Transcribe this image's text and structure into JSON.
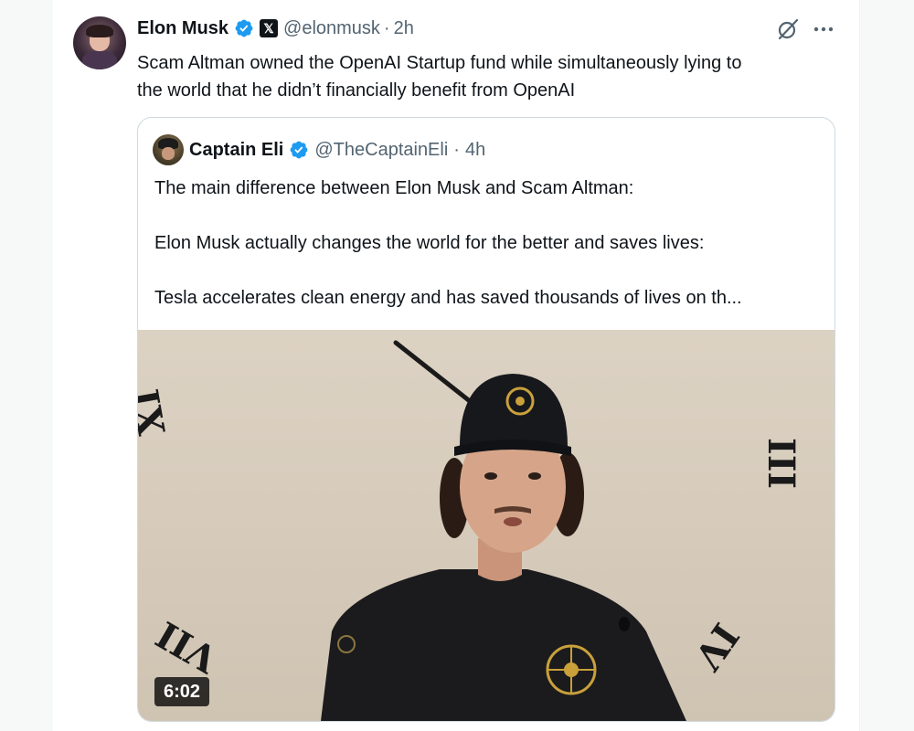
{
  "tweet": {
    "author_name": "Elon Musk",
    "verified_icon": "verified-badge-icon",
    "affiliation_icon": "x-logo-icon",
    "affiliation_glyph": "𝕏",
    "handle": "@elonmusk",
    "separator": "·",
    "time": "2h",
    "text": "Scam Altman owned the OpenAI Startup fund while simultaneously lying to\nthe world that he didn’t financially benefit from OpenAI",
    "actions": {
      "grok_icon": "grok-icon",
      "more_icon": "more-icon",
      "more_glyph": "···"
    }
  },
  "quote": {
    "author_name": "Captain Eli",
    "verified_icon": "verified-badge-icon",
    "handle": "@TheCaptainEli",
    "separator": "·",
    "time": "4h",
    "paragraphs": [
      "The main difference between Elon Musk and Scam Altman:",
      "Elon Musk actually changes the world for the better and saves lives:",
      "Tesla accelerates clean energy and has saved thousands of lives on th..."
    ],
    "media": {
      "type": "video",
      "duration": "6:02",
      "clock_numerals": [
        "XI",
        "III",
        "VII",
        "IV"
      ]
    }
  },
  "colors": {
    "primary_text": "#0f1419",
    "secondary_text": "#536471",
    "verified_blue": "#1d9bf0",
    "border": "#cfd9de"
  }
}
